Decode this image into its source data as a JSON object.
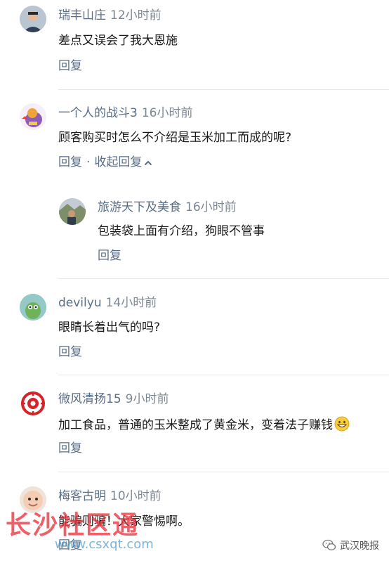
{
  "colors": {
    "name": "#5b6e88",
    "time": "#7d8794",
    "text": "#1a1a1a",
    "divider": "#e6e6e6"
  },
  "comments": [
    {
      "name": "瑞丰山庄",
      "time": "12小时前",
      "text": "差点又误会了我大恩施",
      "reply": "回复"
    },
    {
      "name": "一个人的战斗3",
      "time": "16小时前",
      "text": "顾客购买时怎么不介绍是玉米加工而成的呢?",
      "reply": "回复",
      "separator": "·",
      "collapse": "收起回复",
      "collapse_icon": "chevron-up-icon"
    },
    {
      "name": "旅游天下及美食",
      "time": "16小时前",
      "text": "包装袋上面有介绍，狗眼不管事",
      "reply": "回复"
    },
    {
      "name": "devilyu",
      "time": "14小时前",
      "text": "眼睛长着出气的吗?",
      "reply": "回复"
    },
    {
      "name": "微风清扬15",
      "time": "9小时前",
      "text": "加工食品，普通的玉米整成了黄金米，变着法子赚钱",
      "emoji": "grinning-face-emoji",
      "reply": "回复"
    },
    {
      "name": "梅客古明",
      "time": "10小时前",
      "text": "能骗则骗！大家警惕啊。",
      "reply": "回复"
    }
  ],
  "watermark": {
    "text": "长沙社区通",
    "url": "www.csxqt.com"
  },
  "brand": {
    "label": "武汉晚报",
    "icon": "wechat-icon"
  }
}
